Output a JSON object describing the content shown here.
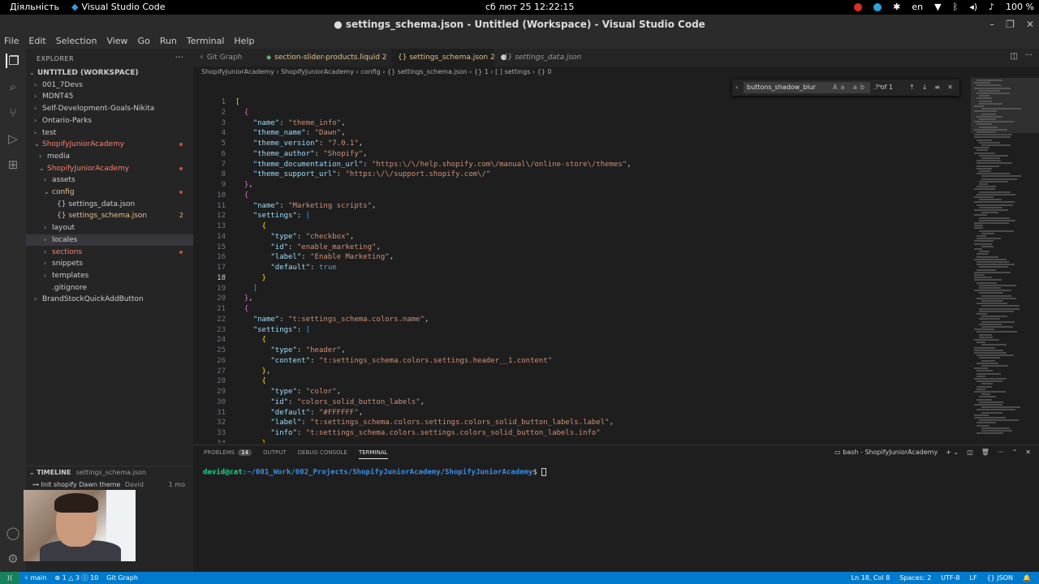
{
  "topbar": {
    "activities": "Діяльність",
    "app_name": "Visual Studio Code",
    "clock": "сб лют 25  12:22:15",
    "lang": "en",
    "battery": "100 %"
  },
  "window": {
    "title": "● settings_schema.json - Untitled (Workspace) - Visual Studio Code"
  },
  "menu": [
    "File",
    "Edit",
    "Selection",
    "View",
    "Go",
    "Run",
    "Terminal",
    "Help"
  ],
  "explorer": {
    "header": "EXPLORER",
    "items": [
      {
        "label": "UNTITLED (WORKSPACE)",
        "chev": "⌄",
        "indent": 0,
        "style": "root"
      },
      {
        "label": "001_7Devs",
        "chev": "›",
        "indent": 1,
        "style": ""
      },
      {
        "label": "MDNT45",
        "chev": "›",
        "indent": 1,
        "style": ""
      },
      {
        "label": "Self-Development-Goals-Nikita",
        "chev": "›",
        "indent": 1,
        "style": ""
      },
      {
        "label": "Ontario-Parks",
        "chev": "›",
        "indent": 1,
        "style": ""
      },
      {
        "label": "test",
        "chev": "›",
        "indent": 1,
        "style": ""
      },
      {
        "label": "ShopifyJuniorAcademy",
        "chev": "⌄",
        "indent": 1,
        "style": "red",
        "dot": true
      },
      {
        "label": "media",
        "chev": "›",
        "indent": 2,
        "style": ""
      },
      {
        "label": "ShopifyJuniorAcademy",
        "chev": "⌄",
        "indent": 2,
        "style": "red",
        "dot": true
      },
      {
        "label": "assets",
        "chev": "›",
        "indent": 3,
        "style": ""
      },
      {
        "label": "config",
        "chev": "⌄",
        "indent": 3,
        "style": "orange",
        "dot": true
      },
      {
        "label": "{} settings_data.json",
        "chev": "",
        "indent": 4,
        "style": ""
      },
      {
        "label": "{} settings_schema.json",
        "chev": "",
        "indent": 4,
        "style": "orange",
        "badge": "2"
      },
      {
        "label": "layout",
        "chev": "›",
        "indent": 3,
        "style": ""
      },
      {
        "label": "locales",
        "chev": "›",
        "indent": 3,
        "style": "",
        "sel": true
      },
      {
        "label": "sections",
        "chev": "›",
        "indent": 3,
        "style": "red",
        "dot": true
      },
      {
        "label": "snippets",
        "chev": "›",
        "indent": 3,
        "style": ""
      },
      {
        "label": "templates",
        "chev": "›",
        "indent": 3,
        "style": ""
      },
      {
        "label": ".gitignore",
        "chev": "",
        "indent": 3,
        "style": ""
      },
      {
        "label": "BrandStockQuickAddButton",
        "chev": "›",
        "indent": 1,
        "style": ""
      }
    ]
  },
  "timeline": {
    "header": "TIMELINE",
    "file": "settings_schema.json",
    "entry": "Init shopify Dawn theme",
    "author": "David",
    "age": "1 mo"
  },
  "tabs": [
    {
      "label": "Git Graph",
      "icon": "⑂",
      "active": false,
      "italic": false
    },
    {
      "label": "section-slider-products.liquid 2",
      "icon": "◆",
      "active": false,
      "italic": false
    },
    {
      "label": "{} settings_schema.json 2",
      "icon": "",
      "active": true,
      "italic": false
    },
    {
      "label": "{} settings_data.json",
      "icon": "",
      "active": false,
      "italic": true
    }
  ],
  "breadcrumb": "ShopifyJuniorAcademy  ›  ShopifyJuniorAcademy  ›  config  ›  {} settings_schema.json  ›  {} 1  ›  [ ] settings  ›  {} 0",
  "find": {
    "query": "buttons_shadow_blur",
    "options": "Aa ab .*",
    "result": "? of 1"
  },
  "code": {
    "current_line": 18,
    "lines": [
      [
        [
          "[",
          "b1"
        ]
      ],
      [
        [
          "  ",
          ""
        ],
        [
          "{",
          "b2"
        ]
      ],
      [
        [
          "    ",
          ""
        ],
        [
          "\"name\"",
          "k"
        ],
        [
          ": ",
          ""
        ],
        [
          "\"theme_info\"",
          "s"
        ],
        [
          ",",
          ""
        ]
      ],
      [
        [
          "    ",
          ""
        ],
        [
          "\"theme_name\"",
          "k"
        ],
        [
          ": ",
          ""
        ],
        [
          "\"Dawn\"",
          "s"
        ],
        [
          ",",
          ""
        ]
      ],
      [
        [
          "    ",
          ""
        ],
        [
          "\"theme_version\"",
          "k"
        ],
        [
          ": ",
          ""
        ],
        [
          "\"7.0.1\"",
          "s"
        ],
        [
          ",",
          ""
        ]
      ],
      [
        [
          "    ",
          ""
        ],
        [
          "\"theme_author\"",
          "k"
        ],
        [
          ": ",
          ""
        ],
        [
          "\"Shopify\"",
          "s"
        ],
        [
          ",",
          ""
        ]
      ],
      [
        [
          "    ",
          ""
        ],
        [
          "\"theme_documentation_url\"",
          "k"
        ],
        [
          ": ",
          ""
        ],
        [
          "\"https:\\/\\/help.shopify.com\\/manual\\/online-store\\/themes\"",
          "s"
        ],
        [
          ",",
          ""
        ]
      ],
      [
        [
          "    ",
          ""
        ],
        [
          "\"theme_support_url\"",
          "k"
        ],
        [
          ": ",
          ""
        ],
        [
          "\"https:\\/\\/support.shopify.com\\/\"",
          "s"
        ]
      ],
      [
        [
          "  ",
          ""
        ],
        [
          "}",
          "b2"
        ],
        [
          ",",
          ""
        ]
      ],
      [
        [
          "  ",
          ""
        ],
        [
          "{",
          "b2"
        ]
      ],
      [
        [
          "    ",
          ""
        ],
        [
          "\"name\"",
          "k"
        ],
        [
          ": ",
          ""
        ],
        [
          "\"Marketing scripts\"",
          "s"
        ],
        [
          ",",
          ""
        ]
      ],
      [
        [
          "    ",
          ""
        ],
        [
          "\"settings\"",
          "k"
        ],
        [
          ": ",
          ""
        ],
        [
          "[",
          "b3"
        ]
      ],
      [
        [
          "      ",
          ""
        ],
        [
          "{",
          "b1"
        ]
      ],
      [
        [
          "        ",
          ""
        ],
        [
          "\"type\"",
          "k"
        ],
        [
          ": ",
          ""
        ],
        [
          "\"checkbox\"",
          "s"
        ],
        [
          ",",
          ""
        ]
      ],
      [
        [
          "        ",
          ""
        ],
        [
          "\"id\"",
          "k"
        ],
        [
          ": ",
          ""
        ],
        [
          "\"enable_marketing\"",
          "s"
        ],
        [
          ",",
          ""
        ]
      ],
      [
        [
          "        ",
          ""
        ],
        [
          "\"label\"",
          "k"
        ],
        [
          ": ",
          ""
        ],
        [
          "\"Enable Marketing\"",
          "s"
        ],
        [
          ",",
          ""
        ]
      ],
      [
        [
          "        ",
          ""
        ],
        [
          "\"default\"",
          "k"
        ],
        [
          ": ",
          ""
        ],
        [
          "true",
          "kw"
        ]
      ],
      [
        [
          "      ",
          ""
        ],
        [
          "}",
          "b1"
        ]
      ],
      [
        [
          "    ",
          ""
        ],
        [
          "]",
          "b3"
        ]
      ],
      [
        [
          "  ",
          ""
        ],
        [
          "}",
          "b2"
        ],
        [
          ",",
          ""
        ]
      ],
      [
        [
          "  ",
          ""
        ],
        [
          "{",
          "b2"
        ]
      ],
      [
        [
          "    ",
          ""
        ],
        [
          "\"name\"",
          "k"
        ],
        [
          ": ",
          ""
        ],
        [
          "\"t:settings_schema.colors.name\"",
          "s"
        ],
        [
          ",",
          ""
        ]
      ],
      [
        [
          "    ",
          ""
        ],
        [
          "\"settings\"",
          "k"
        ],
        [
          ": ",
          ""
        ],
        [
          "[",
          "b3"
        ]
      ],
      [
        [
          "      ",
          ""
        ],
        [
          "{",
          "b1"
        ]
      ],
      [
        [
          "        ",
          ""
        ],
        [
          "\"type\"",
          "k"
        ],
        [
          ": ",
          ""
        ],
        [
          "\"header\"",
          "s"
        ],
        [
          ",",
          ""
        ]
      ],
      [
        [
          "        ",
          ""
        ],
        [
          "\"content\"",
          "k"
        ],
        [
          ": ",
          ""
        ],
        [
          "\"t:settings_schema.colors.settings.header__1.content\"",
          "s"
        ]
      ],
      [
        [
          "      ",
          ""
        ],
        [
          "}",
          "b1"
        ],
        [
          ",",
          ""
        ]
      ],
      [
        [
          "      ",
          ""
        ],
        [
          "{",
          "b1"
        ]
      ],
      [
        [
          "        ",
          ""
        ],
        [
          "\"type\"",
          "k"
        ],
        [
          ": ",
          ""
        ],
        [
          "\"color\"",
          "s"
        ],
        [
          ",",
          ""
        ]
      ],
      [
        [
          "        ",
          ""
        ],
        [
          "\"id\"",
          "k"
        ],
        [
          ": ",
          ""
        ],
        [
          "\"colors_solid_button_labels\"",
          "s"
        ],
        [
          ",",
          ""
        ]
      ],
      [
        [
          "        ",
          ""
        ],
        [
          "\"default\"",
          "k"
        ],
        [
          ": ",
          ""
        ],
        [
          "\"#FFFFFF\"",
          "s"
        ],
        [
          ",",
          ""
        ]
      ],
      [
        [
          "        ",
          ""
        ],
        [
          "\"label\"",
          "k"
        ],
        [
          ": ",
          ""
        ],
        [
          "\"t:settings_schema.colors.settings.colors_solid_button_labels.label\"",
          "s"
        ],
        [
          ",",
          ""
        ]
      ],
      [
        [
          "        ",
          ""
        ],
        [
          "\"info\"",
          "k"
        ],
        [
          ": ",
          ""
        ],
        [
          "\"t:settings_schema.colors.settings.colors_solid_button_labels.info\"",
          "s"
        ]
      ],
      [
        [
          "      ",
          ""
        ],
        [
          "}",
          "b1"
        ],
        [
          ",",
          ""
        ]
      ]
    ]
  },
  "panel": {
    "tabs": [
      "PROBLEMS",
      "OUTPUT",
      "DEBUG CONSOLE",
      "TERMINAL"
    ],
    "problems_count": "14",
    "terminal_name": "bash - ShopifyJuniorAcademy",
    "prompt_user": "david@cat",
    "prompt_path": ":~/001_Work/002_Projects/ShopifyJuniorAcademy/ShopifyJuniorAcademy",
    "prompt_symbol": "$"
  },
  "status": {
    "branch": "main",
    "problems": "⊗ 1 △ 3 ⓘ 10",
    "git_graph": "Git Graph",
    "position": "Ln 18, Col 8",
    "spaces": "Spaces: 2",
    "encoding": "UTF-8",
    "eol": "LF",
    "language": "{} JSON"
  }
}
